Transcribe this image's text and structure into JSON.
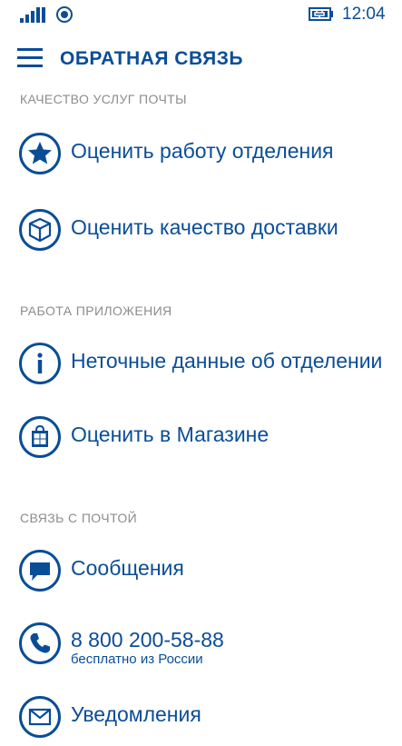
{
  "status": {
    "time": "12:04"
  },
  "header": {
    "title": "ОБРАТНАЯ СВЯЗЬ"
  },
  "sections": [
    {
      "title": "КАЧЕСТВО УСЛУГ ПОЧТЫ",
      "items": [
        {
          "label": "Оценить работу отделения",
          "icon": "star-icon"
        },
        {
          "label": "Оценить качество доставки",
          "icon": "box-icon"
        }
      ]
    },
    {
      "title": "РАБОТА ПРИЛОЖЕНИЯ",
      "items": [
        {
          "label": "Неточные данные об отделении",
          "icon": "info-icon"
        },
        {
          "label": "Оценить в Магазине",
          "icon": "store-icon"
        }
      ]
    },
    {
      "title": "СВЯЗЬ С ПОЧТОЙ",
      "items": [
        {
          "label": "Сообщения",
          "icon": "message-icon"
        },
        {
          "label": "8 800 200-58-88",
          "sublabel": "бесплатно из России",
          "icon": "phone-icon"
        },
        {
          "label": "Уведомления",
          "icon": "mail-icon"
        }
      ]
    }
  ],
  "colors": {
    "accent": "#0a4d97",
    "section_header": "#8c8c8c",
    "background": "#ffffff"
  }
}
